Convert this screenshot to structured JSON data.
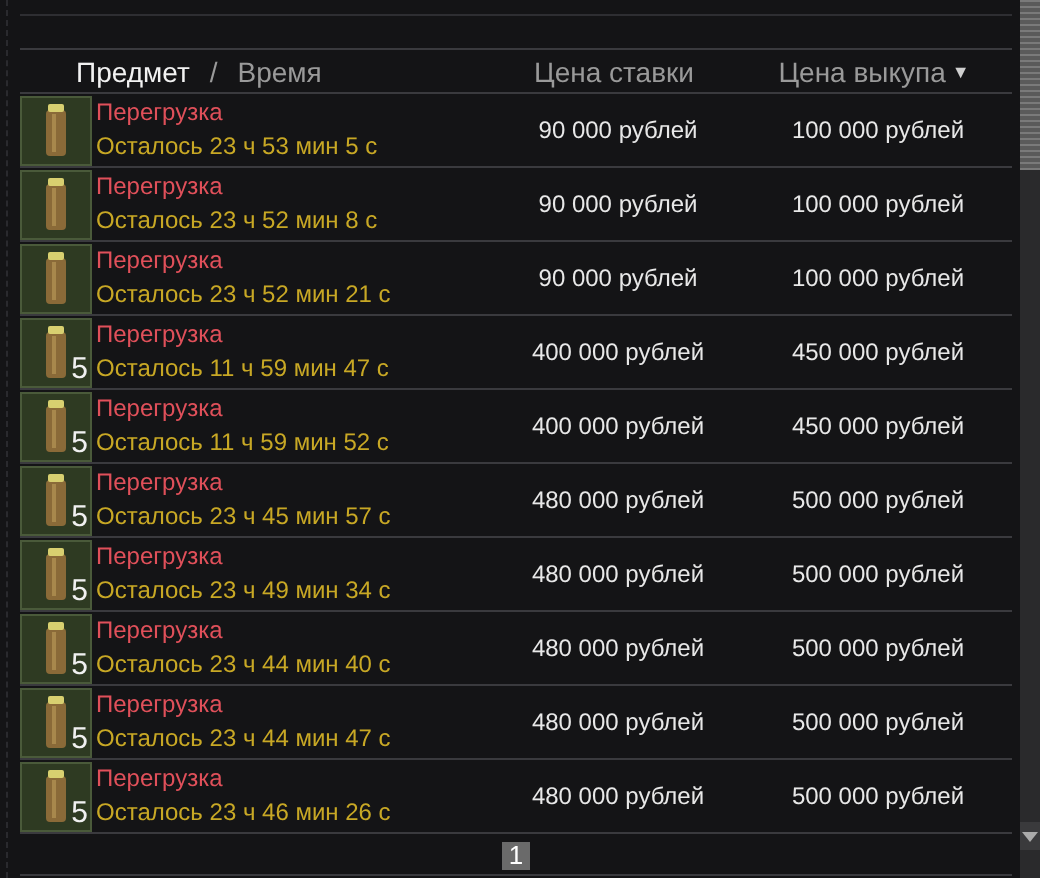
{
  "header": {
    "columns": [
      {
        "label": "Предмет",
        "selected": true
      },
      {
        "label": "Время",
        "selected": false
      },
      {
        "label": "Цена ставки",
        "selected": false
      },
      {
        "label": "Цена выкупа",
        "selected": false,
        "sort_icon": "▼"
      }
    ],
    "separator": "/"
  },
  "rows": [
    {
      "name": "Перегрузка",
      "time": "Осталось 23 ч 53 мин 5 с",
      "bid": "90 000 рублей",
      "buyout": "100 000 рублей"
    },
    {
      "name": "Перегрузка",
      "time": "Осталось 23 ч 52 мин 8 с",
      "bid": "90 000 рублей",
      "buyout": "100 000 рублей"
    },
    {
      "name": "Перегрузка",
      "time": "Осталось 23 ч 52 мин 21 с",
      "bid": "90 000 рублей",
      "buyout": "100 000 рублей"
    },
    {
      "name": "Перегрузка",
      "time": "Осталось 11 ч 59 мин 47 с",
      "bid": "400 000 рублей",
      "buyout": "450 000 рублей",
      "count": "5"
    },
    {
      "name": "Перегрузка",
      "time": "Осталось 11 ч 59 мин 52 с",
      "bid": "400 000 рублей",
      "buyout": "450 000 рублей",
      "count": "5"
    },
    {
      "name": "Перегрузка",
      "time": "Осталось 23 ч 45 мин 57 с",
      "bid": "480 000 рублей",
      "buyout": "500 000 рублей",
      "count": "5"
    },
    {
      "name": "Перегрузка",
      "time": "Осталось 23 ч 49 мин 34 с",
      "bid": "480 000 рублей",
      "buyout": "500 000 рублей",
      "count": "5"
    },
    {
      "name": "Перегрузка",
      "time": "Осталось 23 ч 44 мин 40 с",
      "bid": "480 000 рублей",
      "buyout": "500 000 рублей",
      "count": "5"
    },
    {
      "name": "Перегрузка",
      "time": "Осталось 23 ч 44 мин 47 с",
      "bid": "480 000 рублей",
      "buyout": "500 000 рублей",
      "count": "5"
    },
    {
      "name": "Перегрузка",
      "time": "Осталось 23 ч 46 мин 26 с",
      "bid": "480 000 рублей",
      "buyout": "500 000 рублей",
      "count": "5"
    }
  ],
  "pagination": {
    "pages": [
      {
        "label": "1",
        "selected": true
      }
    ]
  }
}
